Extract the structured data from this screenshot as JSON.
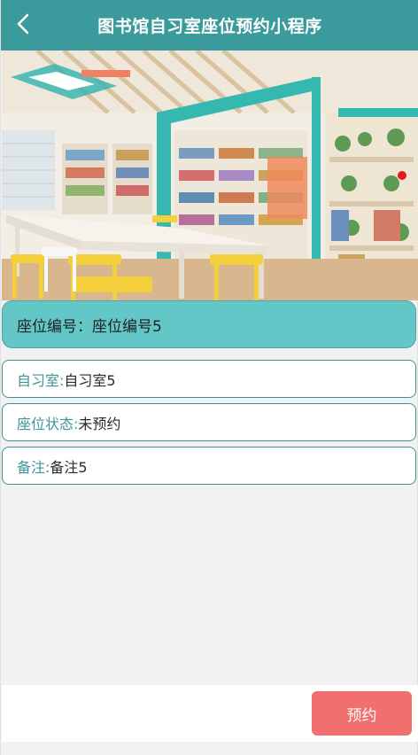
{
  "header": {
    "title": "图书馆自习室座位预约小程序",
    "back_icon": "chevron-left-icon"
  },
  "hero": {
    "image": "library reading room photo"
  },
  "seat": {
    "label": "座位编号：",
    "value": "座位编号5"
  },
  "fields": [
    {
      "label": "自习室:",
      "value": "自习室5"
    },
    {
      "label": "座位状态:",
      "value": "未预约"
    },
    {
      "label": "备注:",
      "value": "备注5"
    }
  ],
  "actions": {
    "reserve_label": "预约"
  },
  "colors": {
    "header": "#3a9a9c",
    "seat_card": "#63c6c7",
    "field_label": "#3d9597",
    "reserve_button": "#f16f6f"
  }
}
